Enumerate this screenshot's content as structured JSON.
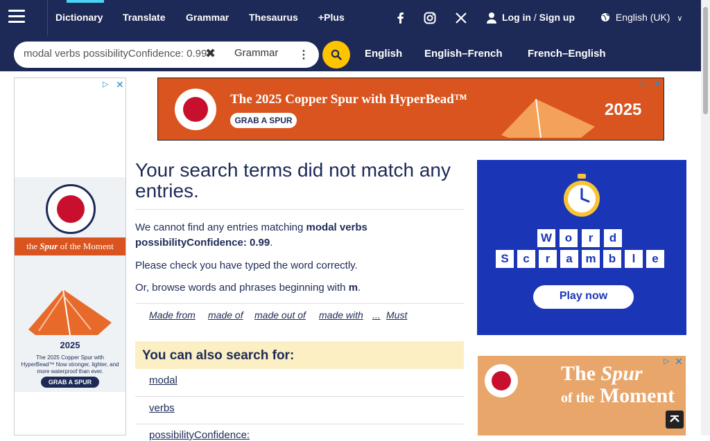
{
  "nav": {
    "items": [
      "Dictionary",
      "Translate",
      "Grammar",
      "Thesaurus",
      "+Plus"
    ],
    "login": "Log in",
    "slash": "/",
    "signup": "Sign up",
    "language": "English (UK)"
  },
  "search": {
    "value": "modal verbs possibilityConfidence: 0.99",
    "dictionary": "Grammar"
  },
  "dict_tabs": [
    "English",
    "English–French",
    "French–English"
  ],
  "ads": {
    "top_headline": "The 2025 Copper Spur with HyperBead™",
    "top_cta": "GRAB A SPUR",
    "top_year": "2025",
    "left_tagline_1": "the",
    "left_tagline_2": "Spur",
    "left_tagline_3": "of the Moment",
    "left_year": "2025",
    "left_copy": "The 2025 Copper Spur with HyperBead™ Now stronger, lighter, and more waterproof than ever.",
    "left_cta": "GRAB A SPUR",
    "right_game_word1": [
      "W",
      "o",
      "r",
      "d"
    ],
    "right_game_word2": [
      "S",
      "c",
      "r",
      "a",
      "m",
      "b",
      "l",
      "e"
    ],
    "right_cta": "Play now",
    "right2_line1": "The",
    "right2_line2": "Spur",
    "right2_line3": "of the",
    "right2_line4": "Moment"
  },
  "main": {
    "title": "Your search terms did not match any entries.",
    "no_match_prefix": "We cannot find any entries matching",
    "no_match_term": "modal verbs possibilityConfidence: 0.99",
    "no_match_suffix": ".",
    "check_text": "Please check you have typed the word correctly.",
    "browse_prefix": "Or, browse words and phrases beginning with",
    "browse_letter": "m",
    "browse_suffix": ".",
    "browse_links": [
      "Made from",
      "made of",
      "made out of",
      "made with",
      "...",
      "Must"
    ],
    "also_heading": "You can also search for:",
    "suggestions": [
      "modal",
      "verbs",
      "possibilityConfidence:"
    ]
  },
  "colors": {
    "navy": "#1d2a57",
    "accent_yellow": "#fec400",
    "active_tab": "#4ad3f4",
    "also_bg": "#fcefc3"
  }
}
